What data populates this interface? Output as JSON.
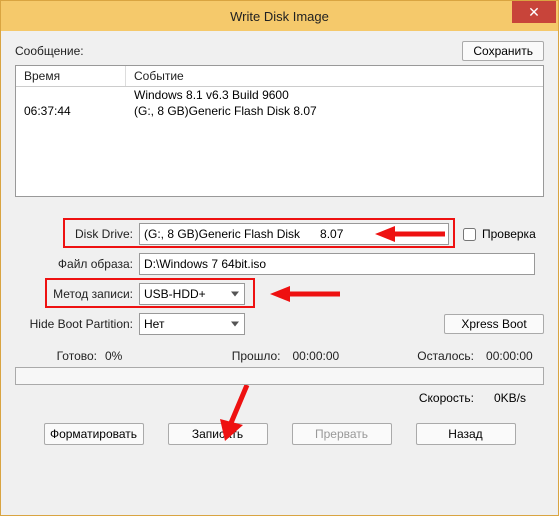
{
  "window": {
    "title": "Write Disk Image"
  },
  "toolbar": {
    "save_label": "Сохранить"
  },
  "message": {
    "label": "Сообщение:"
  },
  "log": {
    "col_time": "Время",
    "col_event": "Событие",
    "rows": [
      {
        "time": "",
        "event": "Windows 8.1 v6.3 Build 9600"
      },
      {
        "time": "06:37:44",
        "event": "(G:, 8 GB)Generic Flash Disk      8.07"
      }
    ]
  },
  "fields": {
    "disk_drive_label": "Disk Drive:",
    "disk_drive_value": "(G:, 8 GB)Generic Flash Disk      8.07",
    "verify_label": "Проверка",
    "image_file_label": "Файл образа:",
    "image_file_value": "D:\\Windows 7 64bit.iso",
    "write_method_label": "Метод записи:",
    "write_method_value": "USB-HDD+",
    "hide_boot_label": "Hide Boot Partition:",
    "hide_boot_value": "Нет",
    "xpress_label": "Xpress Boot"
  },
  "progress": {
    "ready_label": "Готово:",
    "ready_value": "0%",
    "elapsed_label": "Прошло:",
    "elapsed_value": "00:00:00",
    "remain_label": "Осталось:",
    "remain_value": "00:00:00",
    "speed_label": "Скорость:",
    "speed_value": "0KB/s"
  },
  "buttons": {
    "format": "Форматировать",
    "write": "Записать",
    "abort": "Прервать",
    "back": "Назад"
  }
}
